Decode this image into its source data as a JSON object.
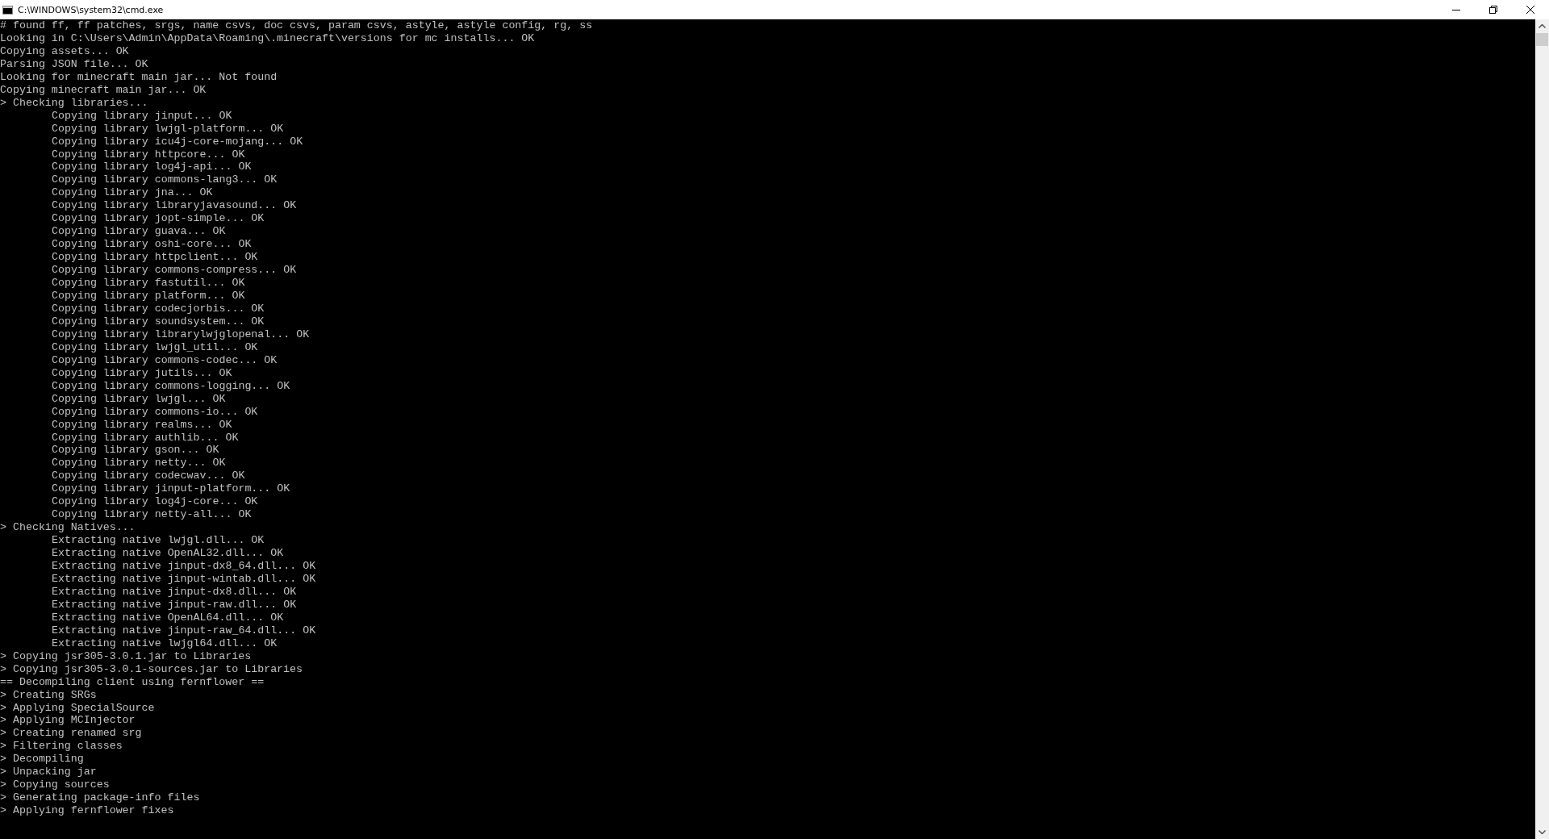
{
  "window": {
    "title": "C:\\WINDOWS\\system32\\cmd.exe"
  },
  "console": {
    "lines": [
      {
        "text": "# found ff, ff patches, srgs, name csvs, doc csvs, param csvs, astyle, astyle config, rg, ss"
      },
      {
        "text": "Looking in C:\\Users\\Admin\\AppData\\Roaming\\.minecraft\\versions for mc installs... OK"
      },
      {
        "text": "Copying assets... OK"
      },
      {
        "text": "Parsing JSON file... OK"
      },
      {
        "text": "Looking for minecraft main jar... Not found"
      },
      {
        "text": "Copying minecraft main jar... OK"
      },
      {
        "text": "> Checking libraries...",
        "children": [
          {
            "text": "Copying library jinput... OK"
          },
          {
            "text": "Copying library lwjgl-platform... OK"
          },
          {
            "text": "Copying library icu4j-core-mojang... OK"
          },
          {
            "text": "Copying library httpcore... OK"
          },
          {
            "text": "Copying library log4j-api... OK"
          },
          {
            "text": "Copying library commons-lang3... OK"
          },
          {
            "text": "Copying library jna... OK"
          },
          {
            "text": "Copying library libraryjavasound... OK"
          },
          {
            "text": "Copying library jopt-simple... OK"
          },
          {
            "text": "Copying library guava... OK"
          },
          {
            "text": "Copying library oshi-core... OK"
          },
          {
            "text": "Copying library httpclient... OK"
          },
          {
            "text": "Copying library commons-compress... OK"
          },
          {
            "text": "Copying library fastutil... OK"
          },
          {
            "text": "Copying library platform... OK"
          },
          {
            "text": "Copying library codecjorbis... OK"
          },
          {
            "text": "Copying library soundsystem... OK"
          },
          {
            "text": "Copying library librarylwjglopenal... OK"
          },
          {
            "text": "Copying library lwjgl_util... OK"
          },
          {
            "text": "Copying library commons-codec... OK"
          },
          {
            "text": "Copying library jutils... OK"
          },
          {
            "text": "Copying library commons-logging... OK"
          },
          {
            "text": "Copying library lwjgl... OK"
          },
          {
            "text": "Copying library commons-io... OK"
          },
          {
            "text": "Copying library realms... OK"
          },
          {
            "text": "Copying library authlib... OK"
          },
          {
            "text": "Copying library gson... OK"
          },
          {
            "text": "Copying library netty... OK"
          },
          {
            "text": "Copying library codecwav... OK"
          },
          {
            "text": "Copying library jinput-platform... OK"
          },
          {
            "text": "Copying library log4j-core... OK"
          },
          {
            "text": "Copying library netty-all... OK"
          }
        ]
      },
      {
        "text": "> Checking Natives...",
        "children": [
          {
            "text": "Extracting native lwjgl.dll... OK"
          },
          {
            "text": "Extracting native OpenAL32.dll... OK"
          },
          {
            "text": "Extracting native jinput-dx8_64.dll... OK"
          },
          {
            "text": "Extracting native jinput-wintab.dll... OK"
          },
          {
            "text": "Extracting native jinput-dx8.dll... OK"
          },
          {
            "text": "Extracting native jinput-raw.dll... OK"
          },
          {
            "text": "Extracting native OpenAL64.dll... OK"
          },
          {
            "text": "Extracting native jinput-raw_64.dll... OK"
          },
          {
            "text": "Extracting native lwjgl64.dll... OK"
          }
        ]
      },
      {
        "text": "> Copying jsr305-3.0.1.jar to Libraries"
      },
      {
        "text": "> Copying jsr305-3.0.1-sources.jar to Libraries"
      },
      {
        "text": "== Decompiling client using fernflower =="
      },
      {
        "text": "> Creating SRGs"
      },
      {
        "text": "> Applying SpecialSource"
      },
      {
        "text": "> Applying MCInjector"
      },
      {
        "text": "> Creating renamed srg"
      },
      {
        "text": "> Filtering classes"
      },
      {
        "text": "> Decompiling"
      },
      {
        "text": "> Unpacking jar"
      },
      {
        "text": "> Copying sources"
      },
      {
        "text": "> Generating package-info files"
      },
      {
        "text": "> Applying fernflower fixes"
      }
    ]
  }
}
